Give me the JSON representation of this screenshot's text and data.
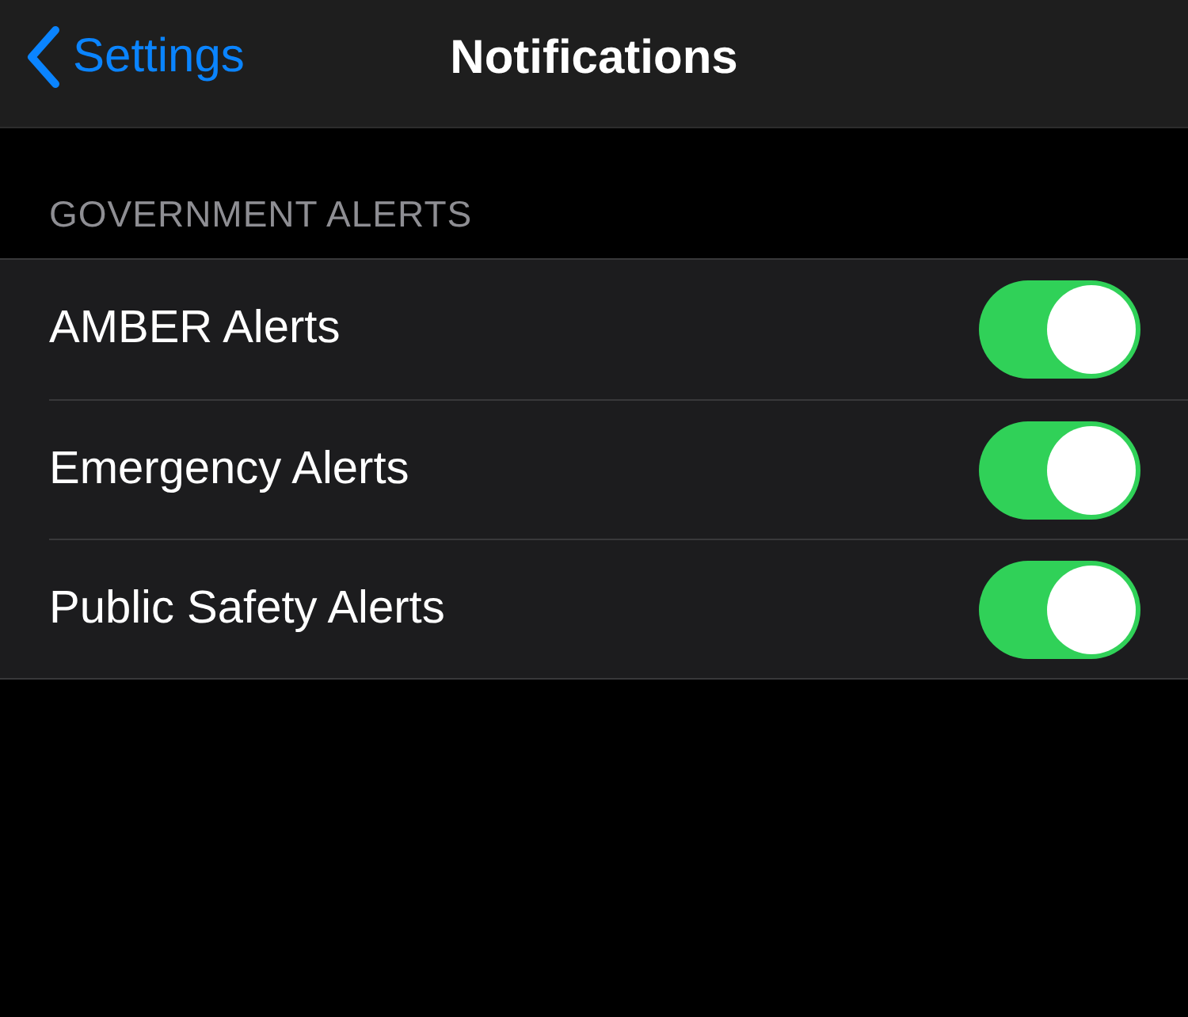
{
  "nav": {
    "back": "Settings",
    "title": "Notifications"
  },
  "section": {
    "header": "GOVERNMENT ALERTS",
    "rows": [
      {
        "label": "AMBER Alerts",
        "on": true
      },
      {
        "label": "Emergency Alerts",
        "on": true
      },
      {
        "label": "Public Safety Alerts",
        "on": true
      }
    ]
  }
}
